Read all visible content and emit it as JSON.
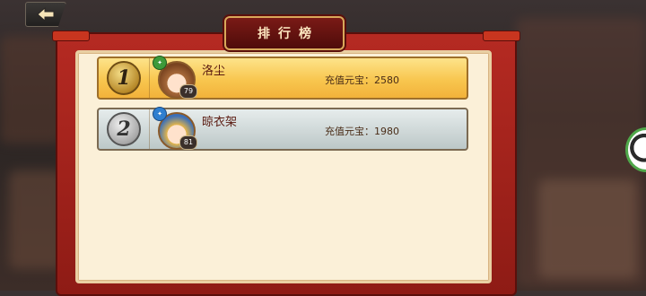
{
  "header": {
    "title": "排行榜",
    "back_icon": "back-arrow-icon"
  },
  "ranking": {
    "rows": [
      {
        "rank": "1",
        "name": "洛尘",
        "level": "79",
        "recharge_label": "充值元宝：",
        "recharge_value": "2580"
      },
      {
        "rank": "2",
        "name": "晾衣架",
        "level": "81",
        "recharge_label": "充值元宝：",
        "recharge_value": "1980"
      }
    ]
  },
  "colors": {
    "panel_red": "#b52a22",
    "row1_gold": "#f8c64f",
    "row2_silver": "#cfd8d8",
    "title_text": "#fde7c0"
  }
}
